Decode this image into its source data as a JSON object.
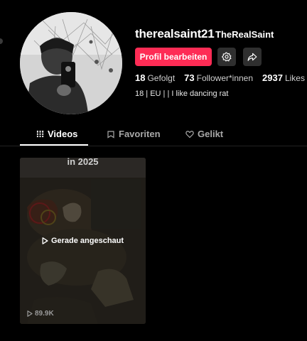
{
  "profile": {
    "username": "therealsaint21",
    "nickname": "TheRealSaint",
    "edit_label": "Profil bearbeiten",
    "bio": "18 | EU | | I like dancing rat"
  },
  "stats": {
    "following": {
      "value": "18",
      "label": "Gefolgt"
    },
    "followers": {
      "value": "73",
      "label": "Follower*innen"
    },
    "likes": {
      "value": "2937",
      "label": "Likes"
    }
  },
  "tabs": {
    "videos": "Videos",
    "favorites": "Favoriten",
    "liked": "Gelikt"
  },
  "video": {
    "caption": "in 2025",
    "watched": "Gerade angeschaut",
    "views": "89.9K"
  },
  "colors": {
    "accent": "#fe2c55",
    "background": "#000000"
  },
  "icons": {
    "settings": "gear-icon",
    "share": "share-icon",
    "videos_tab": "grid-icon",
    "favorites_tab": "bookmark-icon",
    "liked_tab": "heart-icon",
    "play": "play-icon"
  }
}
